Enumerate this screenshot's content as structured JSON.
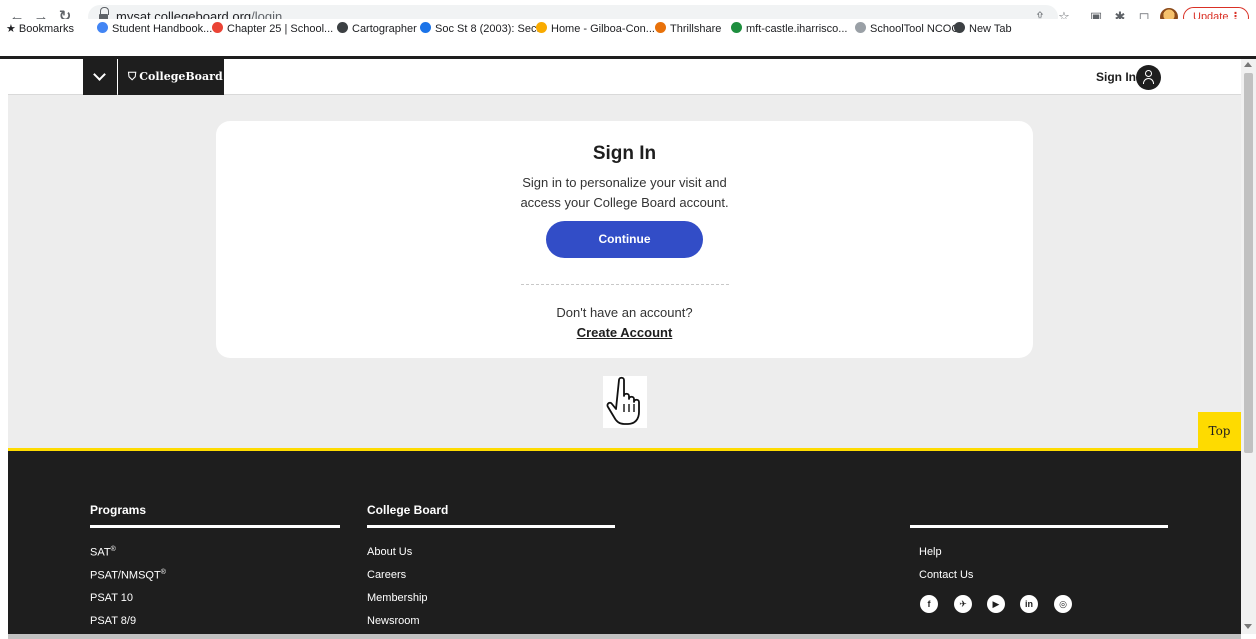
{
  "browser": {
    "url_host": "mysat.collegeboard.org",
    "url_path": "/login",
    "update_label": "Update",
    "bookmarks": [
      {
        "label": "Bookmarks",
        "color": "#202124"
      },
      {
        "label": "Student Handbook...",
        "color": "#4285f4"
      },
      {
        "label": "Chapter 25 | School...",
        "color": "#ea4335"
      },
      {
        "label": "Cartographer",
        "color": "#3c4043"
      },
      {
        "label": "Soc St 8 (2003): Sec...",
        "color": "#1a73e8"
      },
      {
        "label": "Home - Gilboa-Con...",
        "color": "#f9ab00"
      },
      {
        "label": "Thrillshare",
        "color": "#e8710a"
      },
      {
        "label": "mft-castle.iharrisco...",
        "color": "#1e8e3e"
      },
      {
        "label": "SchoolTool NCOC",
        "color": "#9aa0a6"
      },
      {
        "label": "New Tab",
        "color": "#3c4043"
      }
    ]
  },
  "header": {
    "logo": "CollegeBoard",
    "signin_label": "Sign In"
  },
  "card": {
    "title": "Sign In",
    "subtitle_line1": "Sign in to personalize your visit and",
    "subtitle_line2": "access your College Board account.",
    "continue_label": "Continue",
    "no_account": "Don't have an account?",
    "create_account": "Create Account"
  },
  "top_button": "Top",
  "footer": {
    "programs": {
      "heading": "Programs",
      "links": [
        "SAT",
        "PSAT/NMSQT",
        "PSAT 10",
        "PSAT 8/9"
      ]
    },
    "college_board": {
      "heading": "College Board",
      "links": [
        "About Us",
        "Careers",
        "Membership",
        "Newsroom"
      ]
    },
    "help": {
      "links": [
        "Help",
        "Contact Us"
      ]
    },
    "social": [
      "f",
      "t",
      "yt",
      "in",
      "ig"
    ]
  },
  "colors": {
    "accent_blue": "#324dc7",
    "brand_yellow": "#fedb00",
    "dark": "#1e1e1e",
    "page_bg": "#ededed"
  }
}
